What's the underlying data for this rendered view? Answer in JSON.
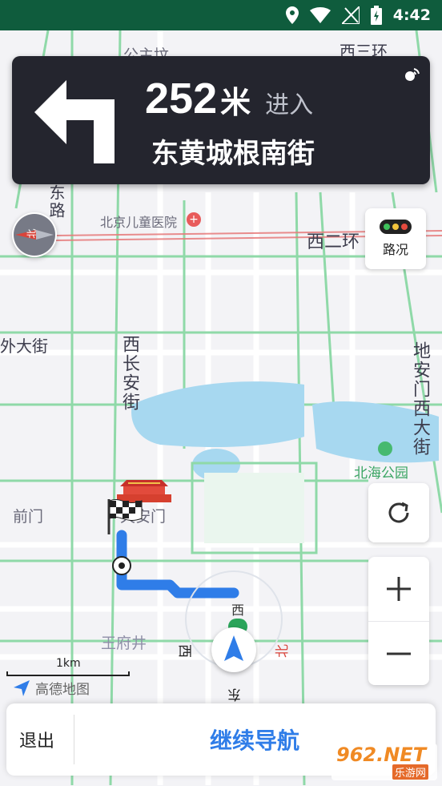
{
  "status_bar": {
    "time": "4:42",
    "icons": [
      "location-icon",
      "wifi-icon",
      "no-signal-icon",
      "battery-charging-icon"
    ]
  },
  "guidance": {
    "distance": "252",
    "unit": "米",
    "action": "进入",
    "street": "东黄城根南街",
    "turn_icon": "turn-left-icon",
    "voice_icon": "voice-broadcast-icon"
  },
  "map_labels": {
    "top_road_1": "西三环",
    "top_road_2": "公主坟",
    "hospital": "北京儿童医院",
    "second_ring": "西二环",
    "west_street": "外大街",
    "xichangan": "西长安街",
    "dianmen": "地安门西大街",
    "beihai": "北海公园",
    "qianmen": "前门",
    "tiananmen": "天安门",
    "wangfujing": "王府井",
    "left_road": "东路",
    "west_badge": "西",
    "direction_west": "西",
    "direction_east": "东",
    "direction_north": "北"
  },
  "controls": {
    "traffic_label": "路况",
    "compass_label": "北",
    "scale_label": "1km"
  },
  "brand": {
    "name": "高德地图"
  },
  "bottom_bar": {
    "exit_label": "退出",
    "continue_label": "继续导航"
  },
  "watermark": {
    "main": "962.NET",
    "sub": "乐游网"
  },
  "colors": {
    "status_bar": "#0f5c3d",
    "card": "#24252e",
    "route": "#2f7de8",
    "accent_text": "#2f7de8",
    "major_road": "#8fd9a8",
    "ring_road": "#e77a7a",
    "water": "#a7d8f0"
  }
}
